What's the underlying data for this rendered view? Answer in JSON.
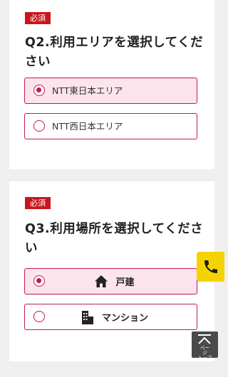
{
  "q2": {
    "badge": "必須",
    "title": "Q2.利用エリアを選択してください",
    "options": [
      {
        "label": "NTT東日本エリア",
        "selected": true
      },
      {
        "label": "NTT西日本エリア",
        "selected": false
      }
    ]
  },
  "q3": {
    "badge": "必須",
    "title": "Q3.利用場所を選択してください",
    "options": [
      {
        "label": "戸建",
        "icon": "house-icon",
        "selected": true
      },
      {
        "label": "マンション",
        "icon": "building-icon",
        "selected": false
      }
    ]
  },
  "floating": {
    "phone_icon": "phone-icon",
    "page_top_label": "ペー\nジ\nトップ",
    "page_top_icon": "arrow-up-icon"
  },
  "colors": {
    "accent": "#c2185b",
    "badge": "#c8161d",
    "selected_bg": "#fce4ec",
    "phone_bg": "#f5d300"
  }
}
